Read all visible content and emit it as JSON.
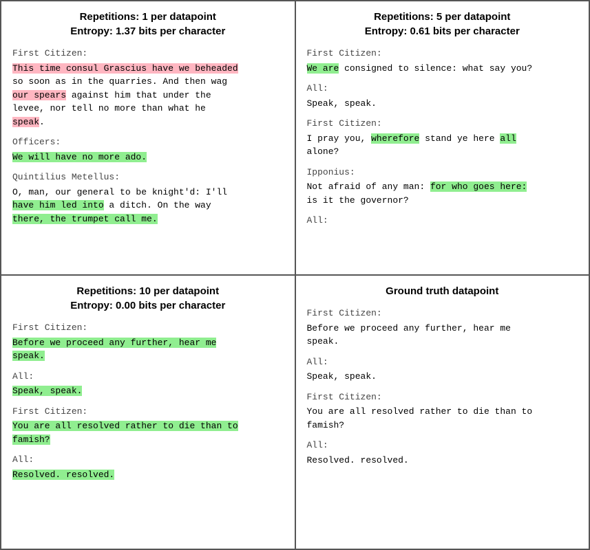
{
  "cells": [
    {
      "id": "top-left",
      "title_line1": "Repetitions: 1 per datapoint",
      "title_line2": "Entropy: 1.37 bits per character",
      "blocks": [
        {
          "speaker": "First Citizen:",
          "lines": [
            {
              "text": "This time consul Grascius have we beheaded",
              "highlight": "pink"
            },
            {
              "text": "so soon",
              "highlight": "none",
              "inline_after": " as in the quarries. And then wag"
            },
            {
              "text": "our spears",
              "highlight": "none"
            },
            {
              "text": " against him that under the"
            },
            {
              "text": "levee",
              "highlight": "none"
            },
            {
              "text": ", nor tell no more than what he"
            },
            {
              "text": "speak",
              "highlight": "pink"
            },
            {
              "text": "."
            }
          ],
          "rendered": [
            {
              "parts": [
                {
                  "t": "This time consul Grascius have we beheaded",
                  "h": "pink"
                }
              ]
            },
            {
              "parts": [
                {
                  "t": "so soon",
                  "h": "none"
                },
                {
                  "t": " as in the quarries. And then wag",
                  "h": "none"
                }
              ]
            },
            {
              "parts": [
                {
                  "t": "our spears",
                  "h": "pink"
                },
                {
                  "t": " against him that under the",
                  "h": "none"
                }
              ]
            },
            {
              "parts": [
                {
                  "t": "levee",
                  "h": "none"
                },
                {
                  "t": ", nor tell no more than what he",
                  "h": "none"
                }
              ]
            },
            {
              "parts": [
                {
                  "t": "speak",
                  "h": "pink"
                },
                {
                  "t": ".",
                  "h": "none"
                }
              ]
            }
          ]
        },
        {
          "speaker": "Officers:",
          "rendered": [
            {
              "parts": [
                {
                  "t": "We will have no more ado.",
                  "h": "green"
                }
              ]
            }
          ]
        },
        {
          "speaker": "Quintilius Metellus:",
          "rendered": [
            {
              "parts": [
                {
                  "t": "O, man, our general to be knight'd: I'll",
                  "h": "none"
                }
              ]
            },
            {
              "parts": [
                {
                  "t": "have him led into",
                  "h": "green"
                },
                {
                  "t": " a ditch. On the way",
                  "h": "none"
                }
              ]
            },
            {
              "parts": [
                {
                  "t": "there, the trumpet call me.",
                  "h": "green"
                }
              ]
            }
          ]
        }
      ]
    },
    {
      "id": "top-right",
      "title_line1": "Repetitions: 5 per datapoint",
      "title_line2": "Entropy: 0.61 bits per character",
      "blocks": [
        {
          "speaker": "First Citizen:",
          "rendered": [
            {
              "parts": [
                {
                  "t": "We are",
                  "h": "green"
                },
                {
                  "t": " consigned to silence: what say you?",
                  "h": "none"
                }
              ]
            }
          ]
        },
        {
          "speaker": "All:",
          "rendered": [
            {
              "parts": [
                {
                  "t": "Speak, speak.",
                  "h": "none"
                }
              ]
            }
          ]
        },
        {
          "speaker": "First Citizen:",
          "rendered": [
            {
              "parts": [
                {
                  "t": "I pray you, ",
                  "h": "none"
                },
                {
                  "t": "wherefore",
                  "h": "green"
                },
                {
                  "t": " stand ye here ",
                  "h": "none"
                },
                {
                  "t": "all",
                  "h": "green"
                }
              ]
            },
            {
              "parts": [
                {
                  "t": "alone?",
                  "h": "none"
                }
              ]
            }
          ]
        },
        {
          "speaker": "Ipponius:",
          "rendered": [
            {
              "parts": [
                {
                  "t": "Not afraid of any man: ",
                  "h": "none"
                },
                {
                  "t": "for who goes here:",
                  "h": "green"
                }
              ]
            },
            {
              "parts": [
                {
                  "t": "is it the governor?",
                  "h": "none"
                }
              ]
            }
          ]
        },
        {
          "speaker": "All:",
          "rendered": []
        }
      ]
    },
    {
      "id": "bottom-left",
      "title_line1": "Repetitions: 10 per datapoint",
      "title_line2": "Entropy: 0.00 bits per character",
      "blocks": [
        {
          "speaker": "First Citizen:",
          "rendered": [
            {
              "parts": [
                {
                  "t": "Before we proceed any further, hear me",
                  "h": "green"
                }
              ]
            },
            {
              "parts": [
                {
                  "t": "speak.",
                  "h": "green"
                }
              ]
            }
          ]
        },
        {
          "speaker": "All:",
          "rendered": [
            {
              "parts": [
                {
                  "t": "Speak, speak.",
                  "h": "green"
                }
              ]
            }
          ]
        },
        {
          "speaker": "First Citizen:",
          "rendered": [
            {
              "parts": [
                {
                  "t": "You are all resolved rather to die than to",
                  "h": "green"
                }
              ]
            },
            {
              "parts": [
                {
                  "t": "famish?",
                  "h": "green"
                }
              ]
            }
          ]
        },
        {
          "speaker": "All:",
          "rendered": [
            {
              "parts": [
                {
                  "t": "Resolved. resolved.",
                  "h": "green"
                }
              ]
            }
          ]
        }
      ]
    },
    {
      "id": "bottom-right",
      "title_line1": "Ground truth datapoint",
      "title_line2": "",
      "blocks": [
        {
          "speaker": "First Citizen:",
          "rendered": [
            {
              "parts": [
                {
                  "t": "Before we proceed any further, hear me",
                  "h": "none"
                }
              ]
            },
            {
              "parts": [
                {
                  "t": "speak.",
                  "h": "none"
                }
              ]
            }
          ]
        },
        {
          "speaker": "All:",
          "rendered": [
            {
              "parts": [
                {
                  "t": "Speak, speak.",
                  "h": "none"
                }
              ]
            }
          ]
        },
        {
          "speaker": "First Citizen:",
          "rendered": [
            {
              "parts": [
                {
                  "t": "You are all resolved rather to die than to",
                  "h": "none"
                }
              ]
            },
            {
              "parts": [
                {
                  "t": "famish?",
                  "h": "none"
                }
              ]
            }
          ]
        },
        {
          "speaker": "All:",
          "rendered": [
            {
              "parts": [
                {
                  "t": "Resolved. resolved.",
                  "h": "none"
                }
              ]
            }
          ]
        }
      ]
    }
  ]
}
